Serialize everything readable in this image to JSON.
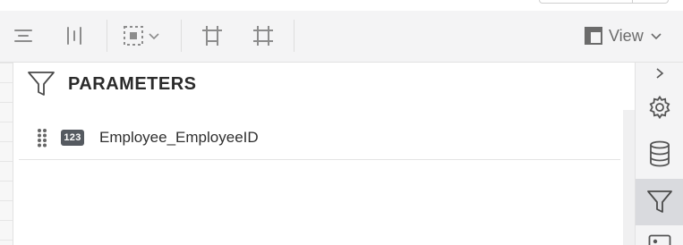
{
  "toolbar": {
    "icons": [
      "distribute-horizontal-icon",
      "distribute-vertical-icon",
      "select-frame-icon",
      "chevron-down-icon",
      "fit-width-icon",
      "fit-whole-icon"
    ],
    "view_label": "View"
  },
  "panel": {
    "title": "PARAMETERS",
    "parameters": [
      {
        "type_badge": "123",
        "name": "Employee_EmployeeID"
      }
    ]
  },
  "sidebar": {
    "items": [
      "expand-icon",
      "settings-icon",
      "database-icon",
      "filter-icon",
      "image-icon"
    ],
    "active_item": "filter-icon"
  },
  "colors": {
    "toolbar_bg": "#f4f4f5",
    "icon_gray": "#8a8a8a",
    "badge_bg": "#555a60",
    "active_sidebar_bg": "#d9dade"
  }
}
